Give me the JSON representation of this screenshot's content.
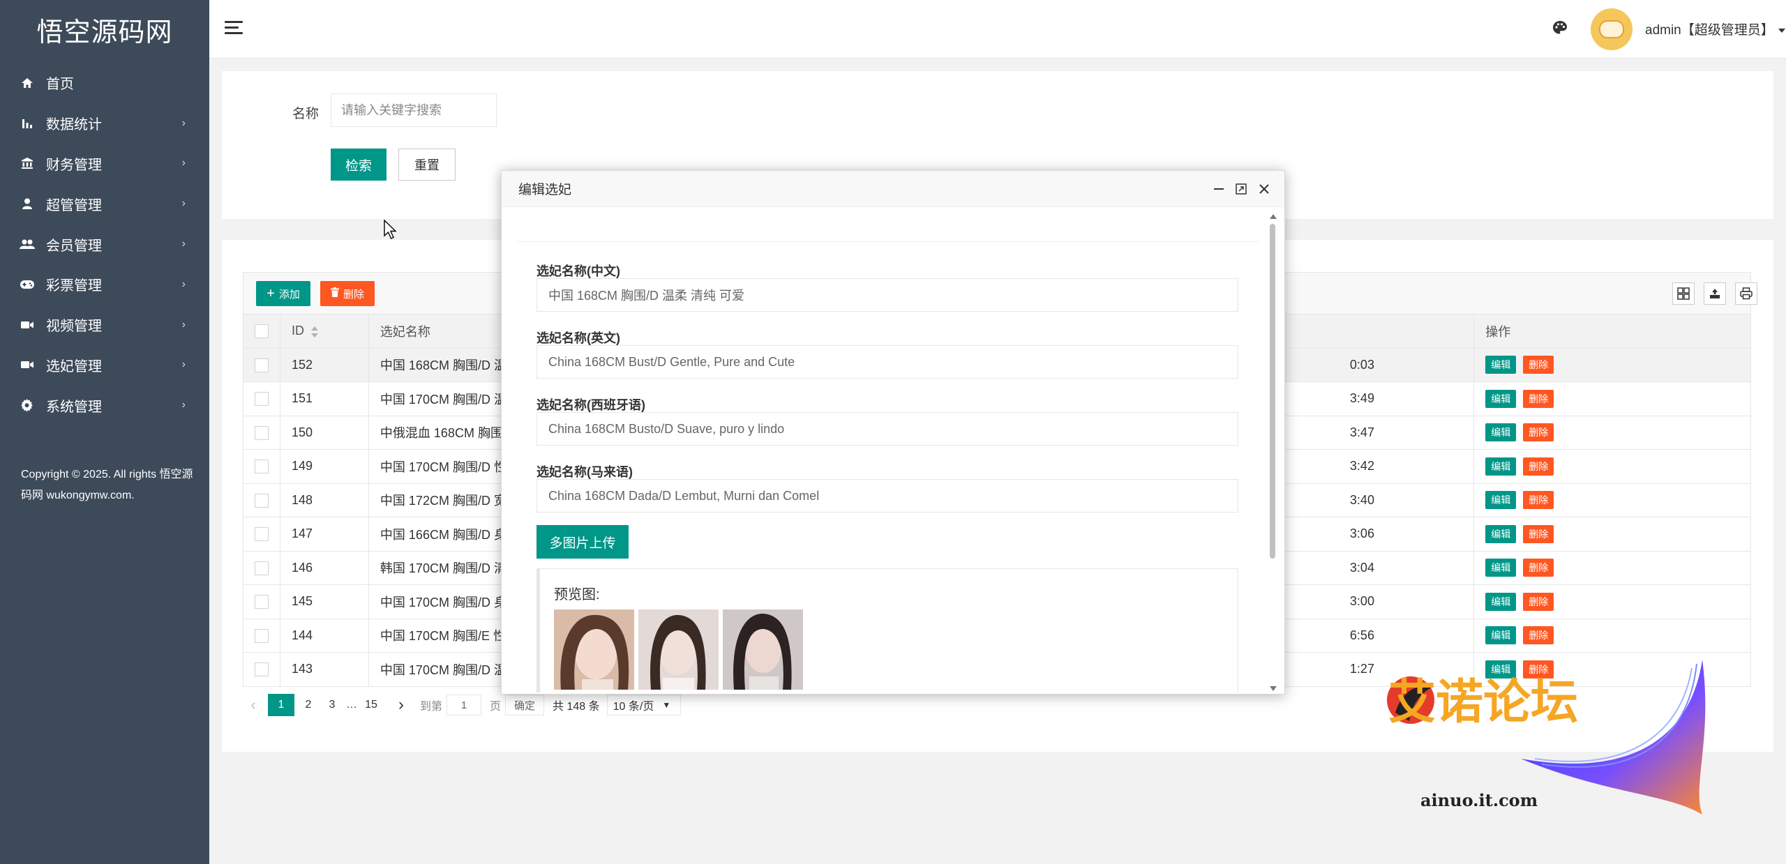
{
  "sidebar": {
    "logo": "悟空源码网",
    "items": [
      {
        "label": "首页",
        "icon": "home-icon",
        "arrow": ""
      },
      {
        "label": "数据统计",
        "icon": "bar-chart-icon",
        "arrow": "›"
      },
      {
        "label": "财务管理",
        "icon": "bank-icon",
        "arrow": "›"
      },
      {
        "label": "超管管理",
        "icon": "user-icon",
        "arrow": "›"
      },
      {
        "label": "会员管理",
        "icon": "users-icon",
        "arrow": "›"
      },
      {
        "label": "彩票管理",
        "icon": "gamepad-icon",
        "arrow": "›"
      },
      {
        "label": "视频管理",
        "icon": "video-icon",
        "arrow": "›"
      },
      {
        "label": "选妃管理",
        "icon": "video-icon",
        "arrow": "›"
      },
      {
        "label": "系统管理",
        "icon": "gear-icon",
        "arrow": "›"
      }
    ],
    "copyright": "Copyright © 2025. All rights 悟空源码网 wukongymw.com."
  },
  "header": {
    "user": "admin【超级管理员】"
  },
  "search": {
    "label": "名称",
    "placeholder": "请输入关键字搜索",
    "search_btn": "检索",
    "reset_btn": "重置"
  },
  "toolbar": {
    "add": "添加",
    "delete": "删除"
  },
  "table": {
    "headers": {
      "id": "ID",
      "name": "选妃名称",
      "ops": "操作"
    },
    "edit_label": "编辑",
    "delete_label": "删除",
    "rows": [
      {
        "id": "152",
        "name": "中国 168CM 胸围/D 温",
        "time": "0:03"
      },
      {
        "id": "151",
        "name": "中国 170CM 胸围/D 温",
        "time": "3:49"
      },
      {
        "id": "150",
        "name": "中俄混血 168CM 胸围",
        "time": "3:47"
      },
      {
        "id": "149",
        "name": "中国 170CM 胸围/D 性",
        "time": "3:42"
      },
      {
        "id": "148",
        "name": "中国 172CM 胸围/D 宽",
        "time": "3:40"
      },
      {
        "id": "147",
        "name": "中国 166CM 胸围/D 身",
        "time": "3:06"
      },
      {
        "id": "146",
        "name": "韩国 170CM 胸围/D 清",
        "time": "3:04"
      },
      {
        "id": "145",
        "name": "中国 170CM 胸围/D 身",
        "time": "3:00"
      },
      {
        "id": "144",
        "name": "中国 170CM 胸围/E 性",
        "time": "6:56"
      },
      {
        "id": "143",
        "name": "中国 170CM 胸围/D 温",
        "time": "1:27"
      }
    ]
  },
  "pager": {
    "prev": "‹",
    "current": "1",
    "p2": "2",
    "p3": "3",
    "ellipsis": "…",
    "last": "15",
    "next": "›",
    "goto": "到第",
    "input": "1",
    "page": "页",
    "confirm": "确定",
    "total": "共 148 条",
    "size": "10 条/页"
  },
  "modal": {
    "title": "编辑选妃",
    "fields": [
      {
        "label": "选妃名称(中文)",
        "value": "中国   168CM  胸围/D   温柔  清纯  可爱"
      },
      {
        "label": "选妃名称(英文)",
        "value": "China 168CM Bust/D Gentle, Pure and Cute"
      },
      {
        "label": "选妃名称(西班牙语)",
        "value": "China 168CM Busto/D Suave, puro y lindo"
      },
      {
        "label": "选妃名称(马来语)",
        "value": "China 168CM Dada/D Lembut, Murni dan Comel"
      }
    ],
    "upload": "多图片上传",
    "preview_title": "预览图:"
  },
  "watermark": {
    "text": "艾诺论坛",
    "url": "ainuo.it.com"
  }
}
